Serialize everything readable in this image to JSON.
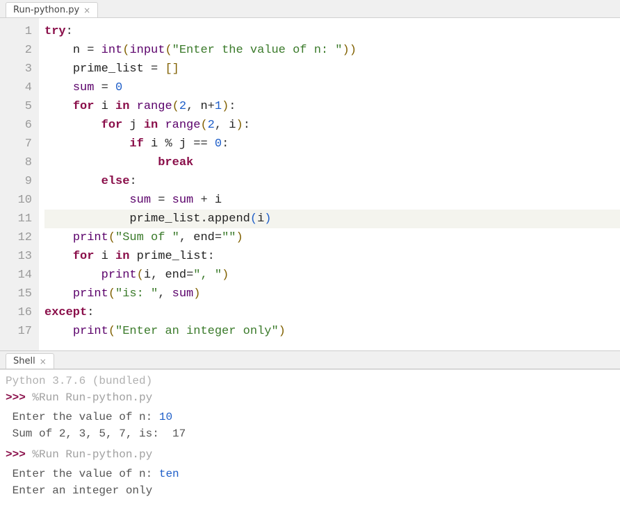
{
  "editor": {
    "tab_title": "Run-python.py",
    "highlighted_line": 11,
    "lines": [
      [
        [
          "kw",
          "try"
        ],
        [
          "op",
          ":"
        ]
      ],
      [
        [
          "sp",
          "    "
        ],
        [
          "id",
          "n "
        ],
        [
          "op",
          "= "
        ],
        [
          "bi",
          "int"
        ],
        [
          "par",
          "("
        ],
        [
          "bi",
          "input"
        ],
        [
          "par",
          "("
        ],
        [
          "str",
          "\"Enter the value of n: \""
        ],
        [
          "par",
          "))"
        ]
      ],
      [
        [
          "sp",
          "    "
        ],
        [
          "id",
          "prime_list "
        ],
        [
          "op",
          "= "
        ],
        [
          "par",
          "[]"
        ]
      ],
      [
        [
          "sp",
          "    "
        ],
        [
          "bi",
          "sum"
        ],
        [
          "id",
          " "
        ],
        [
          "op",
          "= "
        ],
        [
          "num",
          "0"
        ]
      ],
      [
        [
          "sp",
          "    "
        ],
        [
          "kw",
          "for"
        ],
        [
          "id",
          " i "
        ],
        [
          "kw",
          "in"
        ],
        [
          "id",
          " "
        ],
        [
          "bi",
          "range"
        ],
        [
          "par",
          "("
        ],
        [
          "num",
          "2"
        ],
        [
          "op",
          ", "
        ],
        [
          "id",
          "n"
        ],
        [
          "op",
          "+"
        ],
        [
          "num",
          "1"
        ],
        [
          "par",
          ")"
        ],
        [
          "op",
          ":"
        ]
      ],
      [
        [
          "sp",
          "        "
        ],
        [
          "kw",
          "for"
        ],
        [
          "id",
          " j "
        ],
        [
          "kw",
          "in"
        ],
        [
          "id",
          " "
        ],
        [
          "bi",
          "range"
        ],
        [
          "par",
          "("
        ],
        [
          "num",
          "2"
        ],
        [
          "op",
          ", "
        ],
        [
          "id",
          "i"
        ],
        [
          "par",
          ")"
        ],
        [
          "op",
          ":"
        ]
      ],
      [
        [
          "sp",
          "            "
        ],
        [
          "kw",
          "if"
        ],
        [
          "id",
          " i "
        ],
        [
          "op",
          "% "
        ],
        [
          "id",
          "j "
        ],
        [
          "op",
          "== "
        ],
        [
          "num",
          "0"
        ],
        [
          "op",
          ":"
        ]
      ],
      [
        [
          "sp",
          "                "
        ],
        [
          "kw",
          "break"
        ]
      ],
      [
        [
          "sp",
          "        "
        ],
        [
          "kw",
          "else"
        ],
        [
          "op",
          ":"
        ]
      ],
      [
        [
          "sp",
          "            "
        ],
        [
          "bi",
          "sum"
        ],
        [
          "id",
          " "
        ],
        [
          "op",
          "= "
        ],
        [
          "bi",
          "sum"
        ],
        [
          "id",
          " "
        ],
        [
          "op",
          "+ "
        ],
        [
          "id",
          "i"
        ]
      ],
      [
        [
          "sp",
          "            "
        ],
        [
          "id",
          "prime_list.append"
        ],
        [
          "par-hl",
          "("
        ],
        [
          "id",
          "i"
        ],
        [
          "par-hl",
          ")"
        ]
      ],
      [
        [
          "sp",
          "    "
        ],
        [
          "bi",
          "print"
        ],
        [
          "par",
          "("
        ],
        [
          "str",
          "\"Sum of \""
        ],
        [
          "op",
          ", "
        ],
        [
          "id",
          "end"
        ],
        [
          "op",
          "="
        ],
        [
          "str",
          "\"\""
        ],
        [
          "par",
          ")"
        ]
      ],
      [
        [
          "sp",
          "    "
        ],
        [
          "kw",
          "for"
        ],
        [
          "id",
          " i "
        ],
        [
          "kw",
          "in"
        ],
        [
          "id",
          " prime_list"
        ],
        [
          "op",
          ":"
        ]
      ],
      [
        [
          "sp",
          "        "
        ],
        [
          "bi",
          "print"
        ],
        [
          "par",
          "("
        ],
        [
          "id",
          "i"
        ],
        [
          "op",
          ", "
        ],
        [
          "id",
          "end"
        ],
        [
          "op",
          "="
        ],
        [
          "str",
          "\", \""
        ],
        [
          "par",
          ")"
        ]
      ],
      [
        [
          "sp",
          "    "
        ],
        [
          "bi",
          "print"
        ],
        [
          "par",
          "("
        ],
        [
          "str",
          "\"is: \""
        ],
        [
          "op",
          ", "
        ],
        [
          "bi",
          "sum"
        ],
        [
          "par",
          ")"
        ]
      ],
      [
        [
          "kw",
          "except"
        ],
        [
          "op",
          ":"
        ]
      ],
      [
        [
          "sp",
          "    "
        ],
        [
          "bi",
          "print"
        ],
        [
          "par",
          "("
        ],
        [
          "str",
          "\"Enter an integer only\""
        ],
        [
          "par",
          ")"
        ]
      ]
    ]
  },
  "shell": {
    "tab_title": "Shell",
    "version_line": "Python 3.7.6 (bundled)",
    "prompt": ">>>",
    "runs": [
      {
        "cmd": "%Run Run-python.py",
        "io": [
          {
            "prompt": " Enter the value of n: ",
            "user": "10"
          },
          {
            "text": " Sum of 2, 3, 5, 7, is:  17"
          }
        ]
      },
      {
        "cmd": "%Run Run-python.py",
        "io": [
          {
            "prompt": " Enter the value of n: ",
            "user": "ten"
          },
          {
            "text": " Enter an integer only"
          }
        ]
      }
    ]
  }
}
